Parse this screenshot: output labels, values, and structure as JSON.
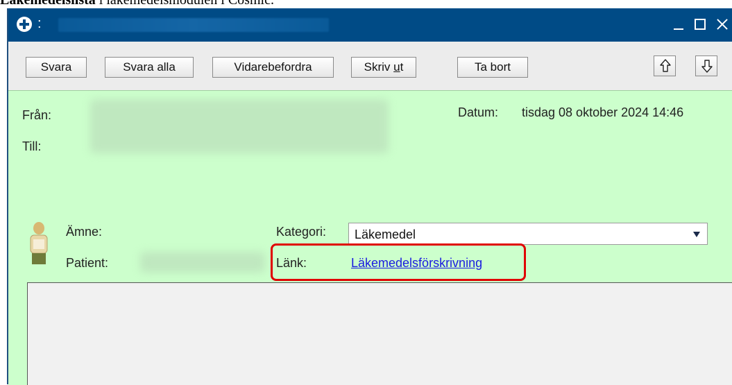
{
  "doc_heading": {
    "bold_part": "Läkemedelslista",
    "rest": " i läkemedelsmodulen i Cosmic."
  },
  "window": {
    "title_separator": ":",
    "controls": {
      "minimize": "minimize-icon",
      "maximize": "maximize-icon",
      "close": "close-icon"
    }
  },
  "toolbar": {
    "reply": "Svara",
    "reply_all": "Svara alla",
    "forward": "Vidarebefordra",
    "print_pre": "Skriv ",
    "print_mnemonic": "u",
    "print_post": "t",
    "delete": "Ta bort",
    "prev_icon": "arrow-up-icon",
    "next_icon": "arrow-down-icon"
  },
  "header": {
    "from_label": "Från:",
    "to_label": "Till:",
    "date_label": "Datum:",
    "date_value": "tisdag 08 oktober 2024 14:46",
    "subject_label": "Ämne:",
    "patient_label": "Patient:",
    "category_label": "Kategori:",
    "category_value": "Läkemedel",
    "link_label": "Länk:",
    "link_text": "Läkemedelsförskrivning"
  },
  "colors": {
    "titlebar": "#004b86",
    "header_bg": "#ccffcc",
    "link": "#1a1ae0",
    "highlight": "#e00000"
  }
}
